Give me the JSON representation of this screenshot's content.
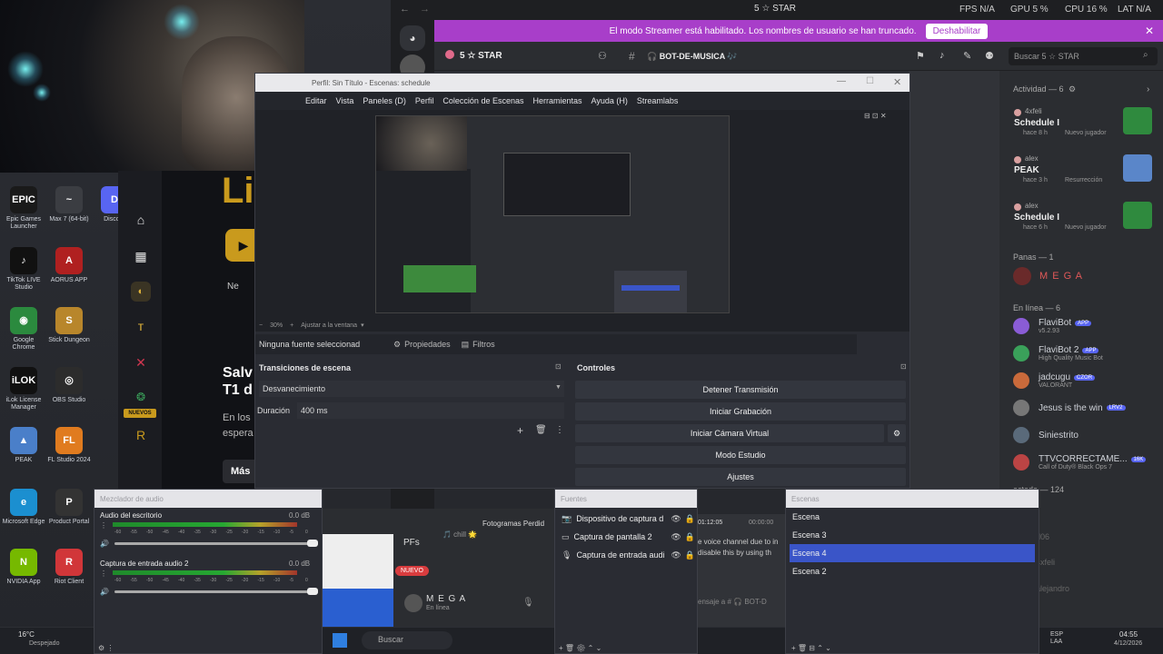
{
  "desktop": {
    "icons": [
      {
        "label": "Epic Games Launcher",
        "color": "#1a1a1a",
        "glyph": "EPIC"
      },
      {
        "label": "Max 7 (64-bit)",
        "color": "#3b3d42",
        "glyph": "~"
      },
      {
        "label": "Discord",
        "color": "#5865f2",
        "glyph": "D"
      },
      {
        "label": "TikTok LIVE Studio",
        "color": "#111111",
        "glyph": "♪"
      },
      {
        "label": "AORUS APP",
        "color": "#b02020",
        "glyph": "A"
      },
      {
        "label": "Google Chrome",
        "color": "#2b8a3e",
        "glyph": "◉"
      },
      {
        "label": "Stick Dungeon",
        "color": "#b8862b",
        "glyph": "S"
      },
      {
        "label": "iLok License Manager",
        "color": "#111111",
        "glyph": "iLOK"
      },
      {
        "label": "OBS Studio",
        "color": "#2c2c2c",
        "glyph": "◎"
      },
      {
        "label": "PEAK",
        "color": "#4a7fc9",
        "glyph": "▲"
      },
      {
        "label": "FL Studio 2024",
        "color": "#e07b1f",
        "glyph": "FL"
      },
      {
        "label": "Microsoft Edge",
        "color": "#1b8fd0",
        "glyph": "e"
      },
      {
        "label": "Product Portal",
        "color": "#333333",
        "glyph": "P"
      },
      {
        "label": "NVIDIA App",
        "color": "#76b900",
        "glyph": "N"
      },
      {
        "label": "Riot Client",
        "color": "#d13639",
        "glyph": "R"
      }
    ]
  },
  "browser": {
    "badge_new": "NUEVOS",
    "headline_1": "Salv",
    "headline_2": "T1 d",
    "body_1": "En los",
    "body_2": "espera",
    "more": "Más",
    "big_letters": "Li",
    "side_text": "Ne"
  },
  "discord": {
    "title_server": "5 ☆ STAR",
    "stats": {
      "fps": "FPS N/A",
      "gpu": "GPU 5 %",
      "cpu": "CPU 16 %",
      "lat": "LAT N/A"
    },
    "banner_text": "El modo Streamer está habilitado. Los nombres de usuario se han truncado.",
    "banner_button": "Deshabilitar",
    "server_name": "5 ☆ STAR",
    "channel": "🎧 BOT-DE-MUSICA 🎶",
    "search_placeholder": "Buscar 5 ☆ STAR",
    "activity_header": "Actividad — 6",
    "activity": [
      {
        "user": "4xfeli",
        "title": "Schedule I",
        "meta": "hace 8 h",
        "tag": "Nuevo jugador"
      },
      {
        "user": "alex",
        "title": "PEAK",
        "meta": "hace 3 h",
        "tag": "Resurrección"
      },
      {
        "user": "alex",
        "title": "Schedule I",
        "meta": "hace 6 h",
        "tag": "Nuevo jugador"
      }
    ],
    "panas_header": "Panas — 1",
    "panas_member": "M E G A",
    "online_header": "En línea — 6",
    "online": [
      {
        "name": "FlaviBot",
        "badge": "APP",
        "sub": "v5.2.93",
        "color": "#8a5cd6"
      },
      {
        "name": "FlaviBot 2",
        "badge": "APP",
        "sub": "High Quality Music Bot",
        "color": "#3aa15a"
      },
      {
        "name": "jadcugu",
        "badge": "CZOR",
        "sub": "VALORANT",
        "color": "#c96a3b"
      },
      {
        "name": "Jesus is the win",
        "badge": "LRV2",
        "sub": "",
        "color": "#777777"
      },
      {
        "name": "Siniestrito",
        "badge": "",
        "sub": "",
        "color": "#5a6a7a"
      },
      {
        "name": "TTVCORRECTAME...",
        "badge": "16K",
        "sub": "Call of Duty® Black Ops 7",
        "color": "#b44"
      }
    ],
    "offline_header": "ectado — 124",
    "offline_names": [
      "d06",
      "4xfeli",
      "alejandro"
    ],
    "voice_text": "PFs",
    "voice_new": "NUEVO",
    "voice_user": "M E G A",
    "voice_status": "En línea",
    "chill": "🎵 chill 🌟",
    "msg_placeholder": "ensaje a # 🎧 BOT-D",
    "chat_line1": "e voice channel due to in",
    "chat_line2": "disable this by using th",
    "photos_label": "Fotogramas Perdid",
    "clock_box": "01:12:05",
    "clock_box2": "00:00:00"
  },
  "taskbar": {
    "weather_temp": "16°C",
    "weather_desc": "Despejado",
    "search": "Buscar",
    "lang": "ESP LAA",
    "time": "04:55",
    "date": "4/12/2026"
  },
  "obs": {
    "title": "Perfil: Sin Título - Escenas: schedule",
    "menu": [
      "Editar",
      "Vista",
      "Paneles (D)",
      "Perfil",
      "Colección de Escenas",
      "Herramientas",
      "Ayuda (H)",
      "Streamlabs"
    ],
    "zoom": "30%",
    "fit": "Ajustar a la ventana",
    "no_source": "Ninguna fuente seleccionad",
    "properties": "Propiedades",
    "filters": "Filtros",
    "transitions_title": "Transiciones de escena",
    "transition": "Desvanecimiento",
    "duration_label": "Duración",
    "duration_value": "400 ms",
    "controls_title": "Controles",
    "controls": [
      "Detener Transmisión",
      "Iniciar Grabación",
      "Iniciar Cámara Virtual",
      "Modo Estudio",
      "Ajustes"
    ],
    "mixer_title": "Mezclador de audio",
    "mixer": [
      {
        "name": "Audio del escritorio",
        "db": "0.0 dB",
        "level": 0.9
      },
      {
        "name": "Captura de entrada audio 2",
        "db": "0.0 dB",
        "level": 0.9
      }
    ],
    "mixer_ticks": [
      "-60",
      "-55",
      "-50",
      "-45",
      "-40",
      "-35",
      "-30",
      "-25",
      "-20",
      "-15",
      "-10",
      "-5",
      "0"
    ],
    "sources_title": "Fuentes",
    "sources": [
      {
        "name": "Dispositivo de captura d",
        "icon": "camera-icon"
      },
      {
        "name": "Captura de pantalla 2",
        "icon": "monitor-icon"
      },
      {
        "name": "Captura de entrada audi",
        "icon": "mic-icon"
      }
    ],
    "scenes_title": "Escenas",
    "scenes": [
      "Escena",
      "Escena 3",
      "Escena 4",
      "Escena 2"
    ],
    "selected_scene": 2
  }
}
